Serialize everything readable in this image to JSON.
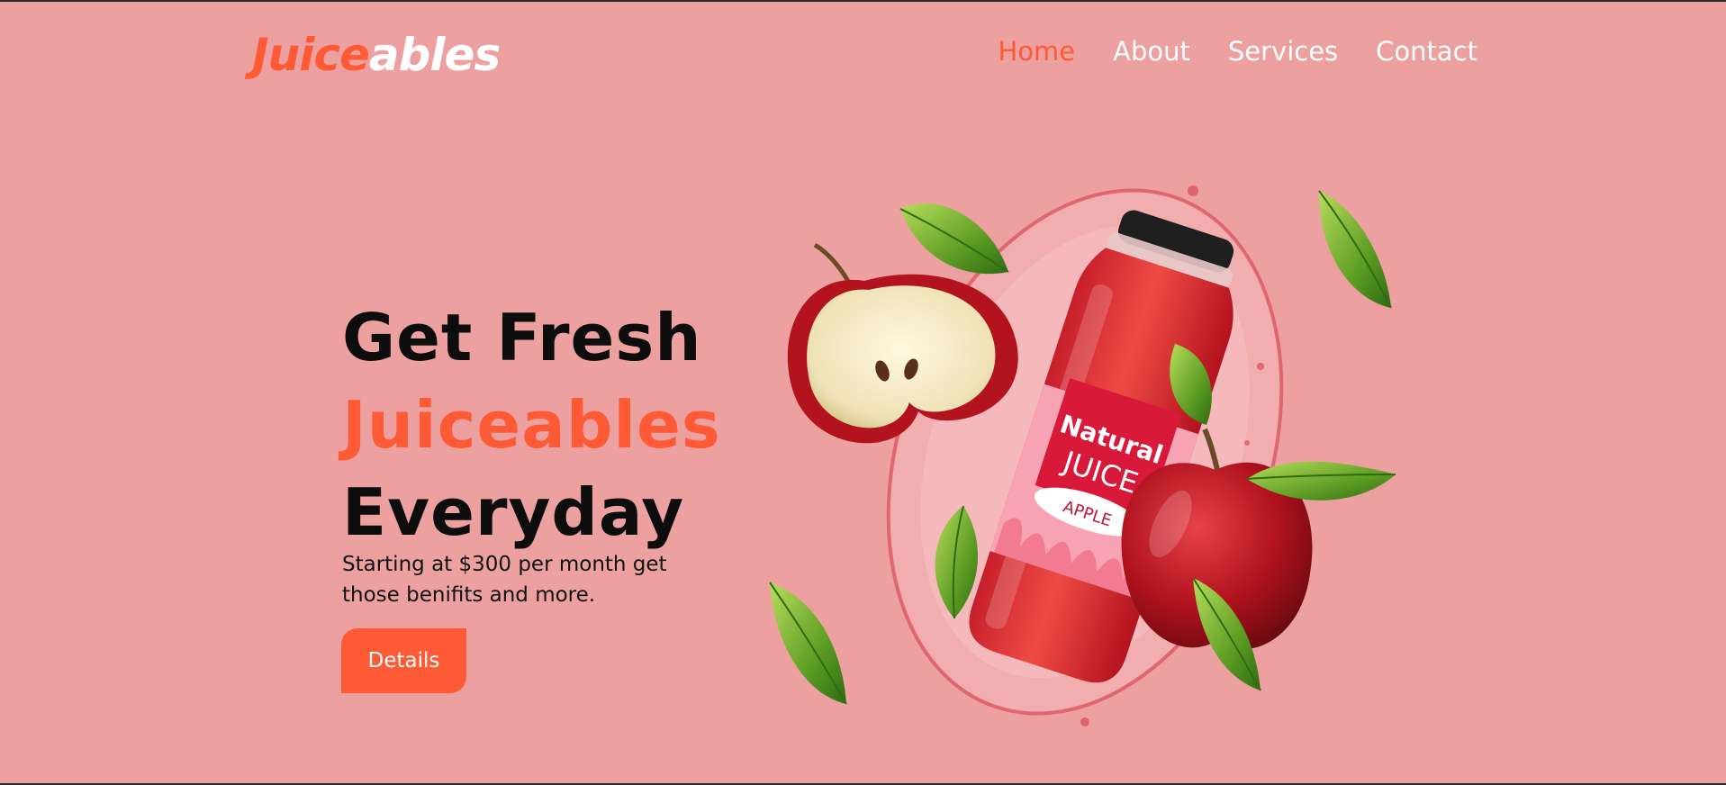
{
  "brand": {
    "part1": "Juice",
    "part2": "ables"
  },
  "nav": {
    "home": "Home",
    "about": "About",
    "services": "Services",
    "contact": "Contact"
  },
  "hero": {
    "line1": "Get Fresh",
    "line2": "Juiceables",
    "line3": "Everyday",
    "subtitle": "Starting at $300 per month get those benifits and more.",
    "button": "Details"
  },
  "product": {
    "label_line1": "Natural",
    "label_line2": "JUICE",
    "flavor": "APPLE"
  },
  "colors": {
    "background": "#eca0a0",
    "accent": "#ff5a36",
    "text": "#0d0d0d",
    "nav_text": "#ffffff"
  }
}
